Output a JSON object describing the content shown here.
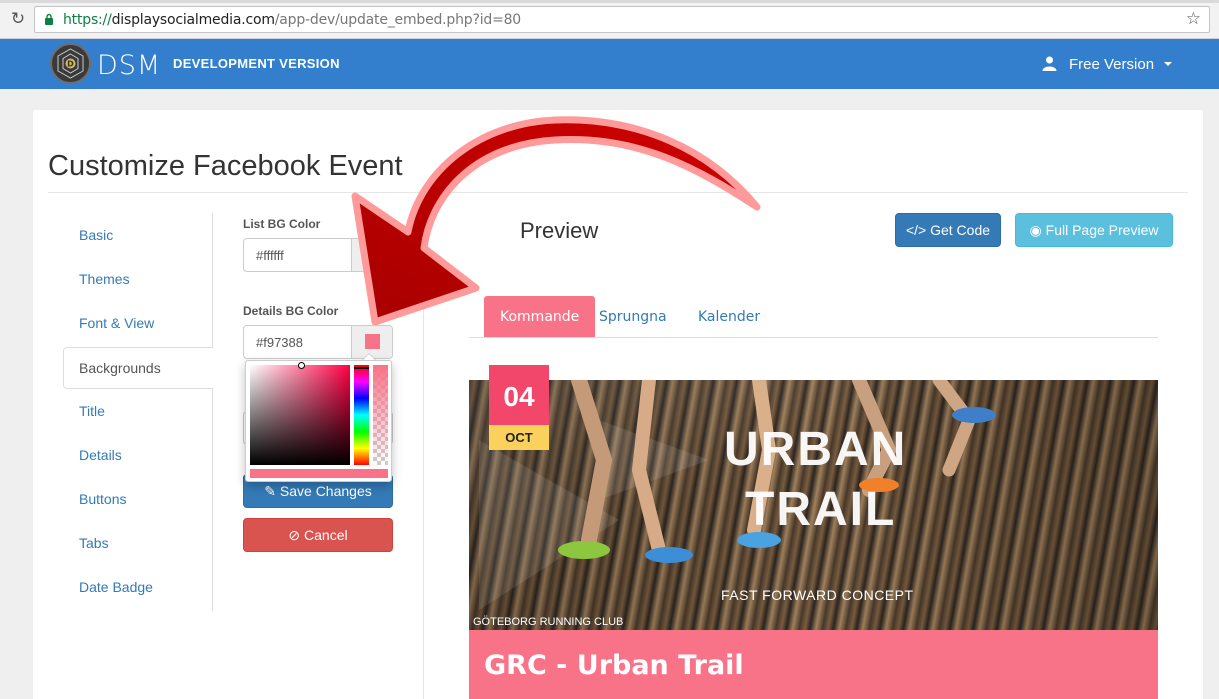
{
  "browser": {
    "url_scheme": "https://",
    "url_host": "displaysocialmedia.com",
    "url_path": "/app-dev/update_embed.php?id=80"
  },
  "navbar": {
    "logo_text": "DSM",
    "dev_label": "DEVELOPMENT VERSION",
    "user_label": "Free Version"
  },
  "page": {
    "title": "Customize Facebook Event"
  },
  "sidebar": {
    "items": [
      {
        "label": "Basic"
      },
      {
        "label": "Themes"
      },
      {
        "label": "Font & View"
      },
      {
        "label": "Backgrounds",
        "active": true
      },
      {
        "label": "Title"
      },
      {
        "label": "Details"
      },
      {
        "label": "Buttons"
      },
      {
        "label": "Tabs"
      },
      {
        "label": "Date Badge"
      }
    ]
  },
  "form": {
    "list_bg_label": "List BG Color",
    "list_bg_value": "#ffffff",
    "details_bg_label": "Details BG Color",
    "details_bg_value": "#f97388",
    "save_label": "Save Changes",
    "cancel_label": "Cancel"
  },
  "preview": {
    "title": "Preview",
    "get_code_label": "Get Code",
    "full_page_label": "Full Page Preview",
    "tabs": [
      {
        "label": "Kommande",
        "active": true
      },
      {
        "label": "Sprungna"
      },
      {
        "label": "Kalender"
      }
    ],
    "event": {
      "day": "04",
      "month": "OCT",
      "image_line1": "URBAN",
      "image_line2": "TRAIL",
      "image_tagline": "FAST FORWARD CONCEPT",
      "image_club": "GÖTEBORG RUNNING CLUB",
      "title": "GRC - Urban Trail"
    }
  },
  "colors": {
    "navbar": "#337fcd",
    "accent_pink": "#f97388",
    "badge_pink": "#f2466a",
    "badge_yellow": "#f9d15c",
    "arrow_red": "#c00000"
  },
  "icons": [
    "reload-icon",
    "lock-icon",
    "star-icon",
    "user-icon",
    "caret-down-icon",
    "code-icon",
    "eye-icon",
    "edit-icon",
    "ban-icon"
  ]
}
